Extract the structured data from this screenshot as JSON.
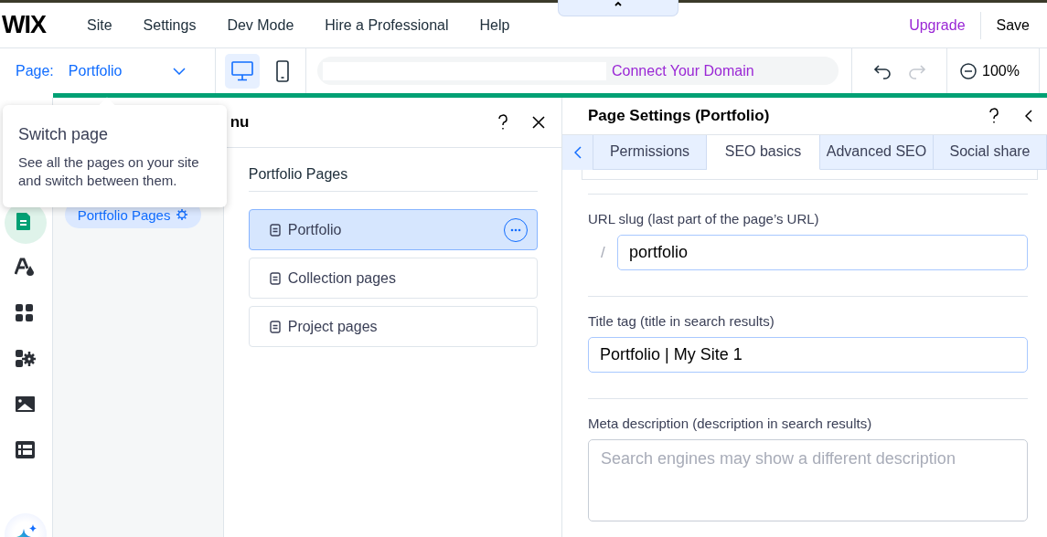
{
  "top_bar": {
    "logo": "WIX",
    "menu": [
      {
        "label": "Site"
      },
      {
        "label": "Settings"
      },
      {
        "label": "Dev Mode"
      },
      {
        "label": "Hire a Professional"
      },
      {
        "label": "Help"
      }
    ],
    "upgrade": "Upgrade",
    "save": "Save"
  },
  "page_bar": {
    "page_label": "Page:",
    "page_name": "Portfolio",
    "devices": [
      {
        "kind": "desktop",
        "selected": true
      },
      {
        "kind": "mobile",
        "selected": false
      }
    ],
    "connect_domain": "Connect Your Domain",
    "history": [
      {
        "kind": "undo",
        "disabled": false
      },
      {
        "kind": "redo",
        "disabled": true
      }
    ],
    "zoom": "100%"
  },
  "left_rail": [
    {
      "kind": "pages",
      "selected": true
    },
    {
      "kind": "theme",
      "selected": false
    },
    {
      "kind": "apps",
      "selected": false
    },
    {
      "kind": "business",
      "selected": false
    },
    {
      "kind": "media",
      "selected": false
    },
    {
      "kind": "cms",
      "selected": false
    },
    {
      "kind": "ai",
      "selected": false
    }
  ],
  "pages_panel": {
    "title": "nu",
    "categories": [
      {
        "label": "Portfolio Pages",
        "selected": true
      }
    ],
    "section_title": "Portfolio Pages",
    "pages": [
      {
        "label": "Portfolio",
        "selected": true
      },
      {
        "label": "Collection pages",
        "selected": false
      },
      {
        "label": "Project pages",
        "selected": false
      }
    ]
  },
  "tooltip": {
    "title": "Switch page",
    "text": "See all the pages on your site and switch between them."
  },
  "settings_panel": {
    "title": "Page Settings (Portfolio)",
    "tabs": [
      {
        "label": "Permissions",
        "selected": false
      },
      {
        "label": "SEO basics",
        "selected": true
      },
      {
        "label": "Advanced SEO",
        "selected": false
      },
      {
        "label": "Social share",
        "selected": false
      }
    ],
    "fields": [
      {
        "kind": "slug",
        "label": "URL slug (last part of the page’s URL)",
        "prefix": "/",
        "value": "portfolio"
      },
      {
        "kind": "text",
        "label": "Title tag (title in search results)",
        "value": "Portfolio | My Site 1"
      },
      {
        "kind": "textarea",
        "label": "Meta description (description in search results)",
        "placeholder": "Search engines may show a different description"
      }
    ]
  }
}
